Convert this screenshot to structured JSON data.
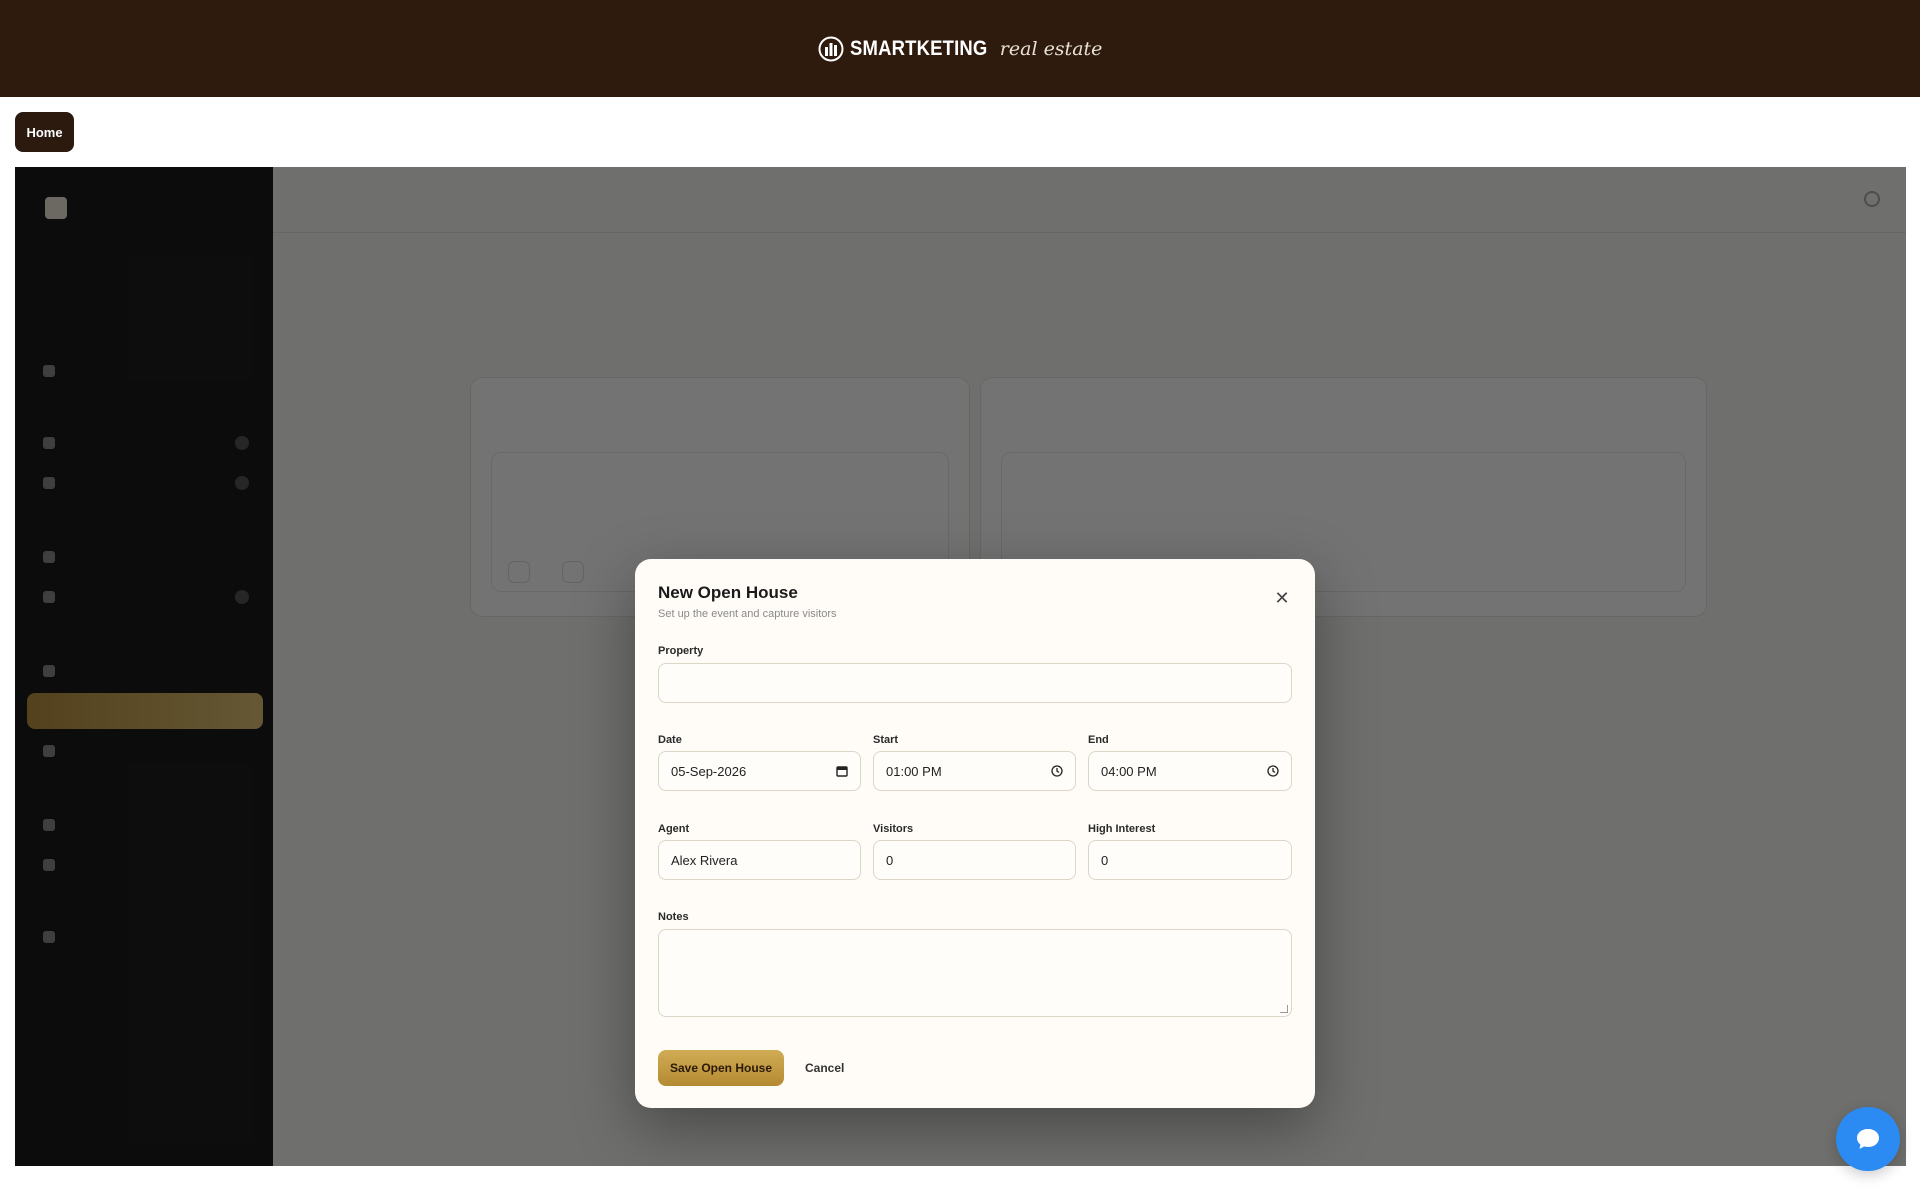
{
  "brand": {
    "name": "SMARTKETING",
    "script": "real estate"
  },
  "nav": {
    "home_label": "Home"
  },
  "modal": {
    "title": "New Open House",
    "subtitle": "Set up the event and capture visitors",
    "fields": {
      "property": {
        "label": "Property",
        "value": ""
      },
      "date": {
        "label": "Date",
        "value": "05-Sep-2026"
      },
      "start": {
        "label": "Start",
        "value": "01:00 PM"
      },
      "end": {
        "label": "End",
        "value": "04:00 PM"
      },
      "agent": {
        "label": "Agent",
        "value": "Alex Rivera"
      },
      "visitors": {
        "label": "Visitors",
        "value": "0"
      },
      "high_interest": {
        "label": "High Interest",
        "value": "0"
      },
      "notes": {
        "label": "Notes",
        "value": ""
      }
    },
    "save_label": "Save Open House",
    "cancel_label": "Cancel",
    "close_glyph": "✕"
  },
  "colors": {
    "topbar": "#2e1b0e",
    "accent_gold": "#c9a14a",
    "chat_blue": "#2b8bf2"
  },
  "icons": {
    "close": "close-icon",
    "calendar": "calendar-icon",
    "clock": "clock-icon",
    "chat": "chat-bubble-icon"
  }
}
